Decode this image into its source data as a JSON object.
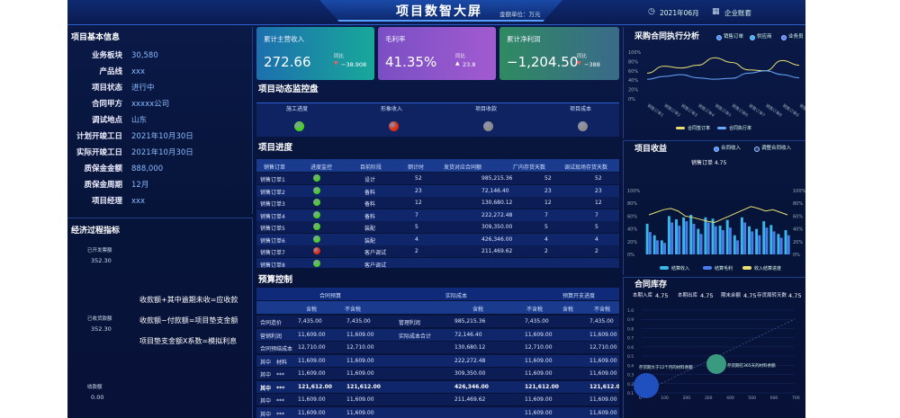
{
  "header": {
    "title": "项目数智大屏",
    "unit": "金额单位：万元",
    "month": "2021年06月",
    "account": "企业账套"
  },
  "basic": {
    "title": "项目基本信息",
    "items": [
      {
        "k": "业务板块",
        "v": "30,580"
      },
      {
        "k": "产品线",
        "v": "xxx"
      },
      {
        "k": "项目状态",
        "v": "进行中"
      },
      {
        "k": "合同甲方",
        "v": "xxxxx公司"
      },
      {
        "k": "调试地点",
        "v": "山东"
      },
      {
        "k": "计划开竣工日",
        "v": "2021年10月30日"
      },
      {
        "k": "实际开竣工日",
        "v": "2021年10月30日"
      },
      {
        "k": "质保金金额",
        "v": "888,000"
      },
      {
        "k": "质保金周期",
        "v": "12月"
      },
      {
        "k": "项目经理",
        "v": "xxx"
      }
    ]
  },
  "econ": {
    "title": "经济过程指标",
    "items": [
      {
        "k": "已开发票额",
        "v": "352.30"
      },
      {
        "k": "已收货款额",
        "v": "352.30"
      },
      {
        "k": "收款额",
        "v": "0.00"
      }
    ],
    "formulas": [
      "收款额+其中逾期未收=应收款",
      "收款额−付款额=项目垫支金额",
      "项目垫支金额X系数=模拟利息"
    ]
  },
  "kpis": [
    {
      "name": "累计主营收入",
      "value": "272.66",
      "cmp_label": "同比",
      "cmp_value": "−38.908",
      "arrow": "▼",
      "arrow_color": "#ff5a5a",
      "c1": "#1d6fae",
      "c2": "#18a89a"
    },
    {
      "name": "毛利率",
      "value": "41.35%",
      "cmp_label": "同比",
      "cmp_value": "23.8",
      "arrow": "▲",
      "arrow_color": "#ffffff",
      "c1": "#7a4fc4",
      "c2": "#a25ad0"
    },
    {
      "name": "累计净利润",
      "value": "−1,204.50",
      "cmp_label": "同比",
      "cmp_value": "−388",
      "arrow": "▼",
      "arrow_color": "#ff5a5a",
      "c1": "#2f8a62",
      "c2": "#3a6a8a"
    }
  ],
  "monitor": {
    "title": "项目动态监控盘",
    "items": [
      {
        "label": "施工进度",
        "color": "#48d020"
      },
      {
        "label": "形象收入",
        "color": "#e02a10"
      },
      {
        "label": "项目收款",
        "color": "#8c8c8c"
      },
      {
        "label": "项目成本",
        "color": "#8c8c8c"
      }
    ]
  },
  "progress": {
    "title": "项目进度",
    "headers": [
      "销售订单",
      "进度监控",
      "目前阶段",
      "倒计时",
      "发货对应合同额",
      "厂内存货天数",
      "调试现场存货天数"
    ],
    "rows": [
      {
        "c": [
          "销售订单1",
          "",
          "设计",
          "52",
          "985,215.36",
          "52",
          "52"
        ],
        "dot": "#48d020"
      },
      {
        "c": [
          "销售订单2",
          "",
          "备料",
          "23",
          "72,146.40",
          "23",
          "23"
        ],
        "dot": "#48d020"
      },
      {
        "c": [
          "销售订单3",
          "",
          "备料",
          "12",
          "130,680.12",
          "12",
          "12"
        ],
        "dot": "#48d020"
      },
      {
        "c": [
          "销售订单4",
          "",
          "备料",
          "7",
          "222,272.48",
          "7",
          "7"
        ],
        "dot": "#48d020"
      },
      {
        "c": [
          "销售订单5",
          "",
          "装配",
          "5",
          "309,350.00",
          "5",
          "5"
        ],
        "dot": "#48d020"
      },
      {
        "c": [
          "销售订单6",
          "",
          "装配",
          "4",
          "426,346.00",
          "4",
          "4"
        ],
        "dot": "#48d020"
      },
      {
        "c": [
          "销售订单7",
          "",
          "客户调试",
          "2",
          "211,469.62",
          "2",
          "2"
        ],
        "dot": "#e02a10"
      },
      {
        "c": [
          "销售订单8",
          "",
          "客户调试",
          "",
          "",
          "",
          ""
        ],
        "dot": "#48d020"
      }
    ]
  },
  "budget": {
    "title": "预算控制",
    "groups": [
      "合同预算",
      "实际成本",
      "预算开支进度"
    ],
    "subs": [
      "含税",
      "不含税",
      "含税",
      "不含税",
      "含税",
      "不含税"
    ],
    "rows": [
      [
        "合同造价",
        "7,435.00",
        "7,435.00",
        "管理利润",
        "985,215.36",
        "7,435.00",
        "7,435.00"
      ],
      [
        "营销利润",
        "11,609.00",
        "11,609.00",
        "实际成本合计",
        "72,146.40",
        "11,609.00",
        "11,609.00"
      ],
      [
        "合同预结成本",
        "12,710.00",
        "12,710.00",
        "",
        "130,680.12",
        "12,710.00",
        "12,710.00"
      ],
      [
        "其中　材料",
        "11,609.00",
        "11,609.00",
        "",
        "222,272.48",
        "11,609.00",
        "11,609.00"
      ],
      [
        "其中　***",
        "11,609.00",
        "11,609.00",
        "",
        "309,350.00",
        "11,609.00",
        "11,609.00"
      ],
      [
        "其中　***",
        "121,612.00",
        "121,612.00",
        "",
        "426,346.00",
        "121,612.00",
        "121,612.00"
      ],
      [
        "其中　***",
        "11,609.00",
        "11,609.00",
        "",
        "211,469.62",
        "11,609.00",
        "11,609.00"
      ],
      [
        "其中　***",
        "11,609.00",
        "11,609.00",
        "",
        "",
        "11,609.00",
        "11,609.00"
      ]
    ],
    "bold_row": 5
  },
  "procure": {
    "title": "采购合同执行分析",
    "legend": [
      "销售订单",
      "供应商",
      "业务员"
    ],
    "yticks": [
      "100%",
      "80%",
      "60%",
      "40%",
      "20%",
      "0%"
    ],
    "xticks": [
      "销售订单1",
      "销售订单2",
      "销售订单3",
      "销售订单4",
      "销售订单5",
      "销售订单6",
      "销售订单7",
      "销售订单8",
      "销售订单9",
      "销售订单10"
    ],
    "bottom_legend": [
      "合同签订率",
      "合同执行率"
    ],
    "chart_data": {
      "type": "line",
      "x": [
        "销售订单1",
        "销售订单2",
        "销售订单3",
        "销售订单4",
        "销售订单5",
        "销售订单6",
        "销售订单7",
        "销售订单8",
        "销售订单9",
        "销售订单10"
      ],
      "ylim": [
        0,
        100
      ],
      "series": [
        {
          "name": "合同签订率",
          "values": [
            55,
            70,
            66,
            72,
            88,
            78,
            62,
            60,
            82,
            72
          ]
        },
        {
          "name": "合同执行率",
          "values": [
            42,
            48,
            52,
            45,
            42,
            44,
            55,
            60,
            52,
            45
          ]
        }
      ]
    }
  },
  "income": {
    "title": "项目收益",
    "legend": [
      "合同收入",
      "调整合同收入"
    ],
    "order_label": "销售订单 4.75",
    "bottom_legend": [
      "结算收入",
      "结算毛利",
      "收入结算进度"
    ],
    "chart_data": {
      "type": "bar",
      "ylim": [
        0,
        100
      ],
      "series": [
        {
          "name": "结算收入",
          "values": [
            48,
            30,
            22,
            60,
            55,
            58,
            62,
            40,
            58,
            56,
            45,
            54,
            30,
            58,
            44,
            40,
            52,
            46,
            32,
            38
          ]
        },
        {
          "name": "结算毛利",
          "values": [
            35,
            22,
            18,
            50,
            45,
            52,
            48,
            32,
            50,
            44,
            38,
            42,
            22,
            50,
            36,
            30,
            42,
            36,
            26,
            30
          ]
        },
        {
          "name": "收入结算进度",
          "values": [
            62,
            66,
            70,
            72,
            68,
            60,
            58,
            55,
            52,
            50,
            55,
            60,
            65,
            70,
            75,
            72,
            68,
            70,
            66,
            62
          ]
        }
      ]
    }
  },
  "stock": {
    "title": "合同库存",
    "stats": [
      {
        "k": "本期入库",
        "v": "4.75"
      },
      {
        "k": "本期出库",
        "v": "4.75"
      },
      {
        "k": "期末余额",
        "v": "4.75"
      },
      {
        "k": "存货周转天数",
        "v": "4.75"
      }
    ],
    "bubbles": [
      "存货期大于12个月的材料余额",
      "存货期在365天的材料余额"
    ],
    "yticks": [
      "1.0",
      "0.9",
      "0.8",
      "0.7",
      "0.6",
      "0.5",
      "0.4",
      "0.3",
      "0.2",
      "0.1"
    ],
    "xticks": [
      "0",
      "100",
      "200",
      "300",
      "400",
      "500",
      "600",
      "700"
    ]
  }
}
